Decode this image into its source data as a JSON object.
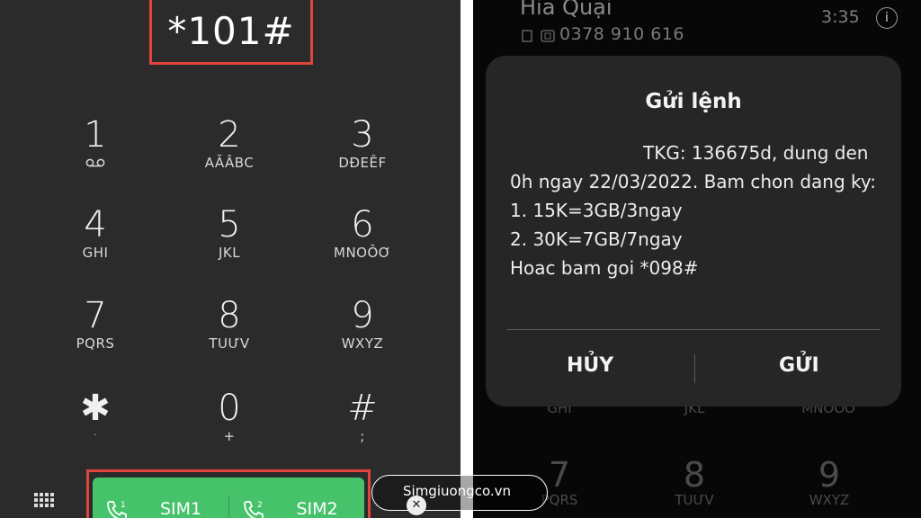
{
  "dialer": {
    "input": "*101#",
    "keys": [
      {
        "digit": "1",
        "letters": ""
      },
      {
        "digit": "2",
        "letters": "AĂÂBC"
      },
      {
        "digit": "3",
        "letters": "DĐEÊF"
      },
      {
        "digit": "4",
        "letters": "GHI"
      },
      {
        "digit": "5",
        "letters": "JKL"
      },
      {
        "digit": "6",
        "letters": "MNOÔƠ"
      },
      {
        "digit": "7",
        "letters": "PQRS"
      },
      {
        "digit": "8",
        "letters": "TUƯV"
      },
      {
        "digit": "9",
        "letters": "WXYZ"
      },
      {
        "digit": "✱",
        "letters": "·"
      },
      {
        "digit": "0",
        "letters": "+"
      },
      {
        "digit": "#",
        "letters": ";"
      }
    ],
    "sim1_label": "SIM1",
    "sim2_label": "SIM2",
    "sim1_badge": "1",
    "sim2_badge": "2"
  },
  "call_screen": {
    "contact_name": "Hia Quại",
    "phone_number": "0378 910 616",
    "time": "3:35",
    "info_symbol": "i",
    "background_keys": [
      {
        "digit": "",
        "letters": "GHI"
      },
      {
        "digit": "",
        "letters": "JKL"
      },
      {
        "digit": "",
        "letters": "MNOÔƠ"
      },
      {
        "digit": "7",
        "letters": "PQRS"
      },
      {
        "digit": "8",
        "letters": "TUƯV"
      },
      {
        "digit": "9",
        "letters": "WXYZ"
      }
    ]
  },
  "dialog": {
    "title": "Gửi lệnh",
    "message_lines": [
      "TKG: 136675d, dung den",
      "0h ngay 22/03/2022. Bam chon dang ky:",
      "1. 15K=3GB/3ngay",
      "2. 30K=7GB/7ngay",
      "Hoac bam goi *098#"
    ],
    "cancel_label": "HỦY",
    "send_label": "GỬI"
  },
  "watermark": {
    "text": "Simgiuongco.vn",
    "close_symbol": "✕"
  },
  "colors": {
    "highlight_border": "#e0453d",
    "call_button": "#46c36a",
    "dialer_bg": "#2b2b2b",
    "dialog_bg": "#262626"
  }
}
